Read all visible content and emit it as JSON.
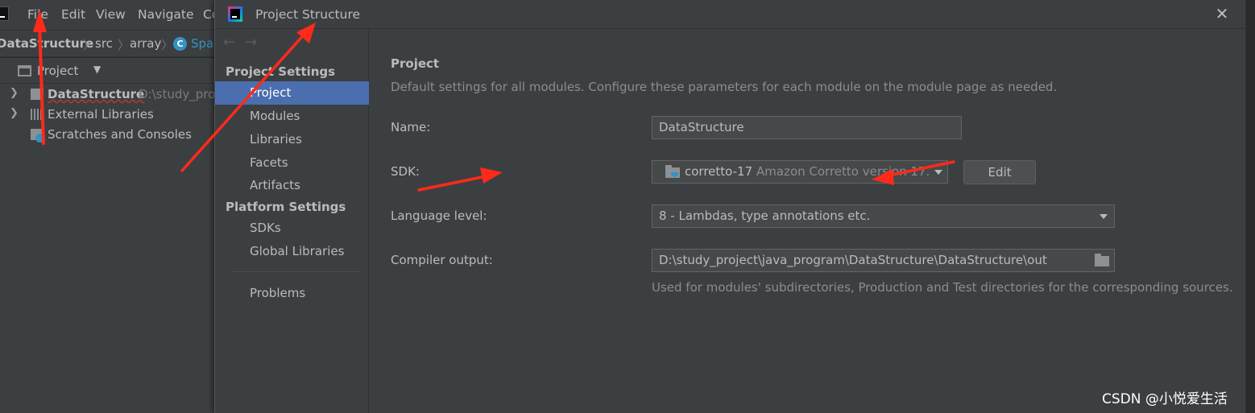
{
  "ide": {
    "menu": {
      "file": "File",
      "edit": "Edit",
      "view": "View",
      "navigate": "Navigate",
      "code": "Co"
    },
    "breadcrumb": {
      "project": "DataStructure",
      "src": "src",
      "array": "array",
      "cls": "Spa",
      "sep": "〉"
    },
    "project_panel": {
      "title": "Project",
      "tree": [
        {
          "label": "DataStructure",
          "path": "D:\\study_pro",
          "icon": "module-folder-icon"
        },
        {
          "label": "External Libraries",
          "icon": "library-icon"
        },
        {
          "label": "Scratches and Consoles",
          "icon": "scratches-icon"
        }
      ]
    }
  },
  "dialog": {
    "title": "Project Structure",
    "close": "✕",
    "nav_back": "←",
    "nav_forward": "→",
    "sidebar": {
      "project_settings_header": "Project Settings",
      "project_items": [
        "Project",
        "Modules",
        "Libraries",
        "Facets",
        "Artifacts"
      ],
      "platform_settings_header": "Platform Settings",
      "platform_items": [
        "SDKs",
        "Global Libraries"
      ],
      "problems": "Problems"
    },
    "main": {
      "heading": "Project",
      "description": "Default settings for all modules. Configure these parameters for each module on the module page as needed.",
      "name_label": "Name:",
      "name_value": "DataStructure",
      "sdk_label": "SDK:",
      "sdk_name": "corretto-17",
      "sdk_desc": "Amazon Corretto version 17.",
      "edit_button": "Edit",
      "language_level_label": "Language level:",
      "language_level_value": "8 - Lambdas, type annotations etc.",
      "compiler_output_label": "Compiler output:",
      "compiler_output_value": "D:\\study_project\\java_program\\DataStructure\\DataStructure\\out",
      "compiler_output_hint": "Used for modules' subdirectories, Production and Test directories for the corresponding sources."
    }
  },
  "watermark": "CSDN @小悦爱生活",
  "colors": {
    "selection": "#4b6eaf",
    "arrow": "#ff2a1a",
    "panel": "#3c3f41",
    "editor": "#2b2b2b"
  }
}
